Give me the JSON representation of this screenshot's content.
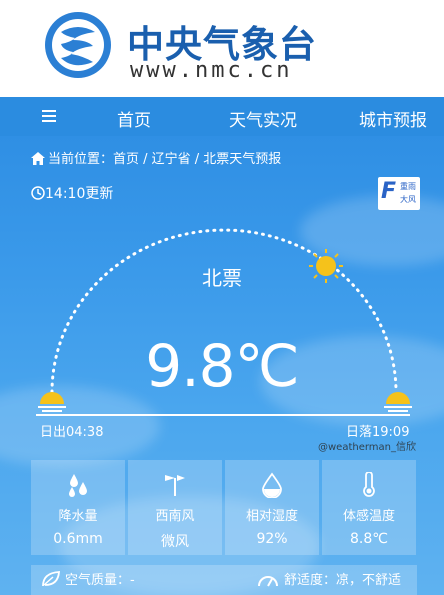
{
  "header": {
    "site_title": "中央气象台",
    "site_url": "www.nmc.cn"
  },
  "nav": {
    "items": [
      "首页",
      "天气实况",
      "城市预报"
    ]
  },
  "breadcrumb": {
    "prefix": "当前位置：",
    "path": "首页 / 辽宁省 / 北票天气预报"
  },
  "update_time": "14:10更新",
  "warning_badge": {
    "letter": "F",
    "line1": "重雨",
    "line2": "大风"
  },
  "weather": {
    "city": "北票",
    "temperature": "9.8℃",
    "sunrise": "日出04:38",
    "sunset": "日落19:09"
  },
  "stats": [
    {
      "icon": "rain-drops-icon",
      "label": "降水量",
      "value": "0.6mm"
    },
    {
      "icon": "wind-vane-icon",
      "label": "西南风",
      "value": "微风"
    },
    {
      "icon": "humidity-drop-icon",
      "label": "相对湿度",
      "value": "92%"
    },
    {
      "icon": "thermometer-icon",
      "label": "体感温度",
      "value": "8.8℃"
    }
  ],
  "bottom": {
    "air_quality": "空气质量：-",
    "comfort": "舒适度：凉，不舒适"
  },
  "watermark": "@weatherman_信欣",
  "colors": {
    "brand_blue": "#1a5fae",
    "nav_blue": "#2b8ce0",
    "sun_yellow": "#f5c21b"
  }
}
